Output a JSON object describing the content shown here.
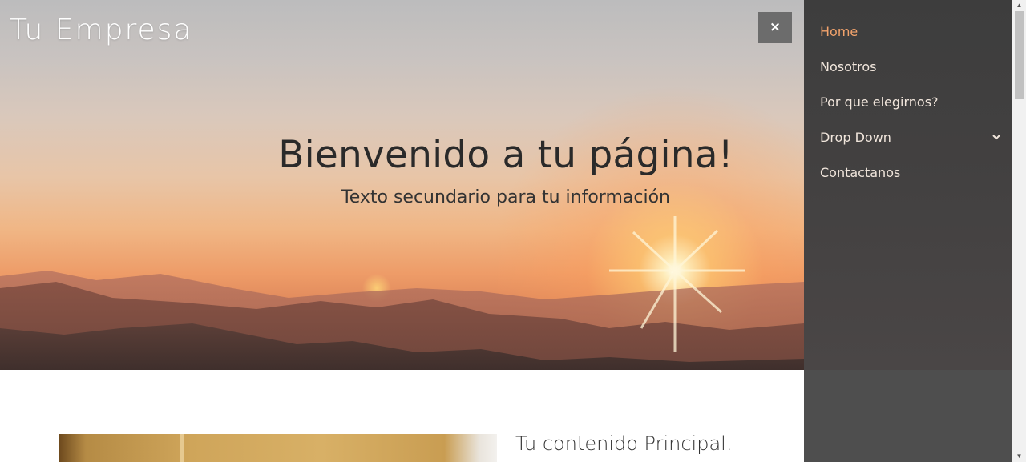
{
  "brand": {
    "name": "Tu Empresa"
  },
  "close_button": {
    "label": "×"
  },
  "hero": {
    "title": "Bienvenido a tu página!",
    "subtitle": "Texto secundario para tu información"
  },
  "nav": {
    "items": [
      {
        "label": "Home",
        "active": true
      },
      {
        "label": "Nosotros",
        "active": false
      },
      {
        "label": "Por que elegirnos?",
        "active": false
      },
      {
        "label": "Drop Down",
        "active": false,
        "has_dropdown": true
      },
      {
        "label": "Contactanos",
        "active": false
      }
    ],
    "dropdown_icon": "chevron-down-icon"
  },
  "content": {
    "title": "Tu contenido Principal."
  },
  "colors": {
    "nav_active": "#f2a36c",
    "nav_text": "#f1e6dc",
    "nav_bg": "#434141",
    "close_bg": "#6c6c6c"
  }
}
